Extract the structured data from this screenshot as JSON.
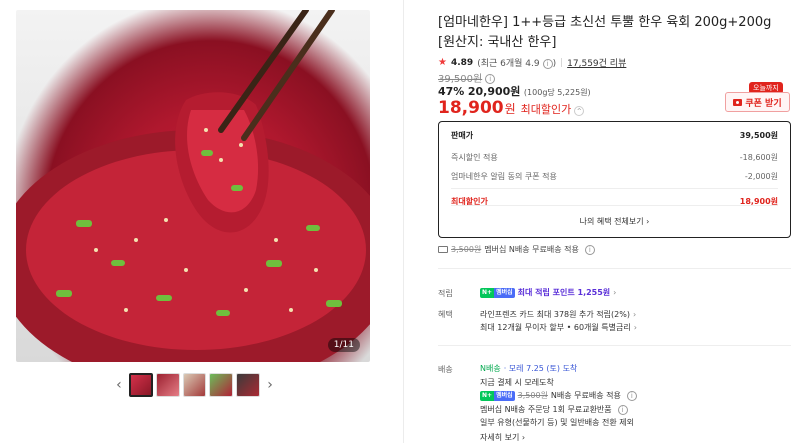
{
  "gallery": {
    "counter": "1/11",
    "prev_arrow": "‹",
    "next_arrow": "›",
    "thumbnails": [
      "thumb-1",
      "thumb-2",
      "thumb-3",
      "thumb-4",
      "thumb-5"
    ],
    "active_index": 0
  },
  "product": {
    "title": "[엄마네한우] 1++등급 초신선 투뿔 한우 육회 200g+200g [원산지: 국내산 한우]",
    "rating": "4.89",
    "rating_recent": "(최근 6개월 4.9",
    "rating_recent_close": ")",
    "review_count": "17,559건 리뷰",
    "original_price": "39,500원",
    "discount_percent": "47%",
    "discount_price": "20,900원",
    "unit_price": "(100g당 5,225원)",
    "final_price": "18,900",
    "final_won": "원",
    "final_label": "최대할인가",
    "today_badge": "오늘까지",
    "coupon_label": "쿠폰 받기"
  },
  "price_box": {
    "rows": [
      {
        "label": "판매가",
        "value": "39,500원"
      },
      {
        "label": "즉시할인 적용",
        "value": "-18,600원"
      },
      {
        "label": "엄마네한우 알림 동의 쿠폰 적용",
        "value": "-2,000원"
      }
    ],
    "max_label": "최대할인가",
    "max_value": "18,900원",
    "benefits_link": "나의 혜택 전체보기 ›"
  },
  "shipping_top": {
    "old_fee": "3,500원",
    "text": "멤버십 N배송 무료배송 적용"
  },
  "points": {
    "label": "적립",
    "badge_n": "N+",
    "badge_m": "멤버십",
    "text": "최대 적립 포인트 1,255원",
    "chev": "›"
  },
  "benefits": {
    "label": "혜택",
    "line1": "라인프렌즈 카드 최대 378원 추가 적립(2%)",
    "line2": "최대 12개월 무이자 할부 • 60개월 특별금리",
    "chev": "›"
  },
  "delivery": {
    "label": "배송",
    "badge": "N배송",
    "eta": "· 모레 7.25 (토) 도착",
    "line1": "지금 결제 시 모레도착",
    "old_fee": "3,500원",
    "line2_text": "N배송 무료배송 적용",
    "line3": "멤버십 N배송 주문당 1회 무료교환반품",
    "line4": "일부 유형(선물하기 등) 및 일반배송 전환 제외",
    "more": "자세히 보기 ›"
  },
  "colors": {
    "accent_red": "#e0241d",
    "npay_green": "#03c75a",
    "membership_blue": "#4a6cf7",
    "points_purple": "#5a2fd8"
  }
}
